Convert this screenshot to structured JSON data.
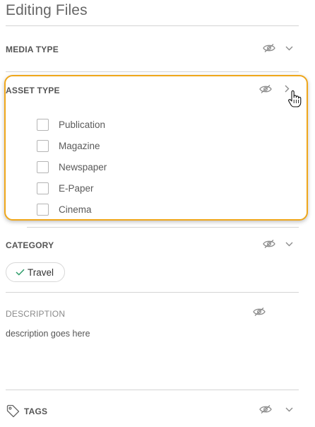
{
  "page": {
    "title": "Editing Files"
  },
  "sections": {
    "media_type": {
      "label": "MEDIA TYPE"
    },
    "asset_type": {
      "label": "ASSET TYPE",
      "options": [
        "Publication",
        "Magazine",
        "Newspaper",
        "E-Paper",
        "Cinema"
      ]
    },
    "category": {
      "label": "CATEGORY",
      "chips": [
        {
          "label": "Travel"
        }
      ]
    },
    "description": {
      "label": "DESCRIPTION",
      "value": "description goes here"
    },
    "tags": {
      "label": "TAGS"
    }
  },
  "colors": {
    "highlight": "#efa71b",
    "check": "#2e9d6a",
    "icon": "#8c8c8c",
    "divider": "#d4d4d4"
  },
  "icons": {
    "visibility": "eye-slash-icon",
    "expand": "chevron-down-icon",
    "collapse": "chevron-right-icon",
    "cursor": "hand-pointer-icon",
    "tag": "tag-icon",
    "chip_check": "check-icon"
  }
}
